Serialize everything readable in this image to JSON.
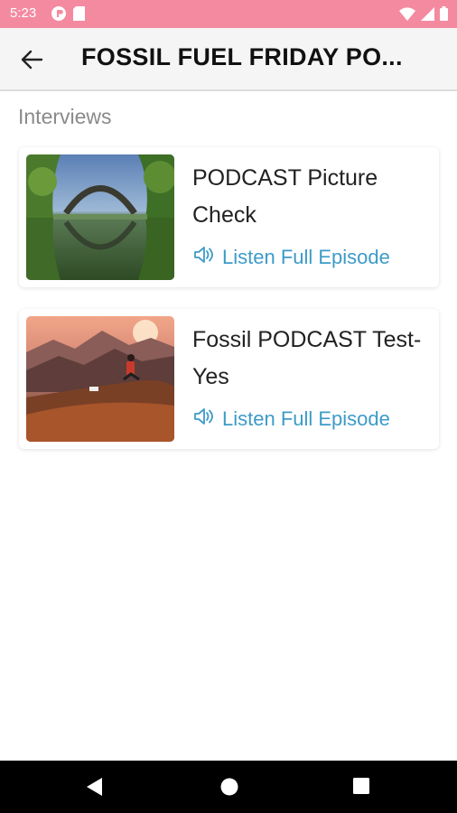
{
  "status": {
    "time": "5:23"
  },
  "app_bar": {
    "title": "FOSSIL FUEL FRIDAY PO..."
  },
  "section": {
    "heading": "Interviews"
  },
  "episodes": [
    {
      "title": "PODCAST Picture Check",
      "listen_label": "Listen Full Episode"
    },
    {
      "title": "Fossil PODCAST Test-Yes",
      "listen_label": "Listen Full Episode"
    }
  ],
  "colors": {
    "status_bar": "#f48aa0",
    "accent": "#3d9bc8",
    "app_bar": "#f5f5f5"
  },
  "icons": {
    "back": "arrow-back-icon",
    "listen": "speaker-icon",
    "nav": [
      "back-triangle-icon",
      "home-circle-icon",
      "recents-square-icon"
    ]
  }
}
